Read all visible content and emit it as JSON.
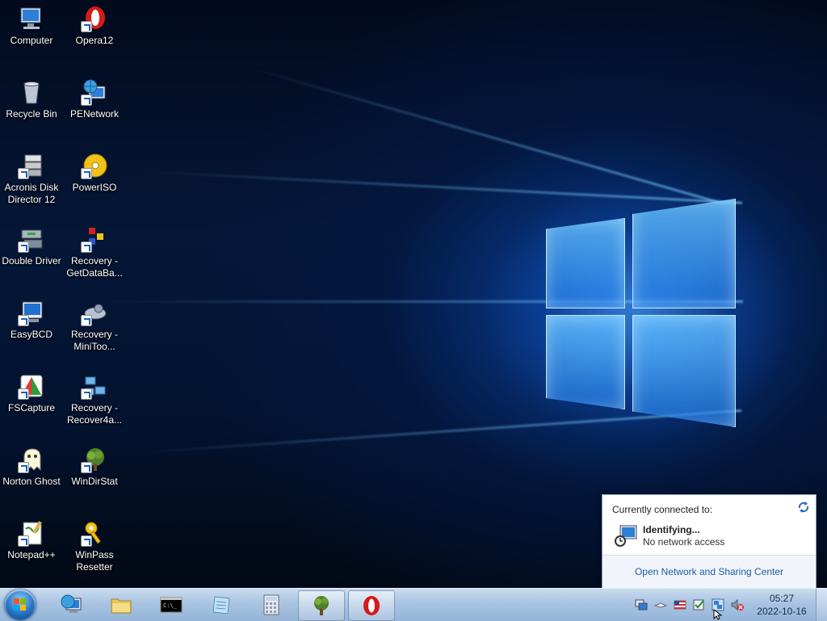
{
  "desktop": {
    "icons": [
      {
        "label": "Computer",
        "icon": "computer-icon"
      },
      {
        "label": "Opera12",
        "icon": "opera-icon"
      },
      {
        "label": "Recycle Bin",
        "icon": "recycle-bin-icon"
      },
      {
        "label": "PENetwork",
        "icon": "network-globe-icon"
      },
      {
        "label": "Acronis Disk Director 12",
        "icon": "disk-director-icon"
      },
      {
        "label": "PowerISO",
        "icon": "disc-icon"
      },
      {
        "label": "Double Driver",
        "icon": "double-driver-icon"
      },
      {
        "label": "Recovery - GetDataBa...",
        "icon": "recovery-icon"
      },
      {
        "label": "EasyBCD",
        "icon": "easybcd-icon"
      },
      {
        "label": "Recovery - MiniToo...",
        "icon": "recovery-minitool-icon"
      },
      {
        "label": "FSCapture",
        "icon": "fscapture-icon"
      },
      {
        "label": "Recovery - Recover4a...",
        "icon": "recovery-folder-icon"
      },
      {
        "label": "Norton Ghost",
        "icon": "ghost-icon"
      },
      {
        "label": "WinDirStat",
        "icon": "windirstat-icon"
      },
      {
        "label": "Notepad++",
        "icon": "notepad-icon"
      },
      {
        "label": "WinPass Resetter",
        "icon": "key-icon"
      }
    ]
  },
  "network_popup": {
    "header": "Currently connected to:",
    "network_name": "Identifying...",
    "network_status": "No network access",
    "link": "Open Network and Sharing Center"
  },
  "taskbar": {
    "start": "start-orb-icon",
    "pinned": [
      "ie-icon",
      "folder-icon",
      "cmd-icon",
      "notepad-icon",
      "calculator-icon",
      "windirstat-icon",
      "opera-icon"
    ],
    "tray": [
      "network-monitor-icon",
      "arrow-icon",
      "flag-us-icon",
      "action-center-icon",
      "network-icon",
      "volume-muted-icon"
    ],
    "time": "05:27",
    "date": "2022-10-16"
  },
  "colors": {
    "taskbar_top": "#c9dcef",
    "link": "#1f5aa8",
    "desktop_glow": "#50aaff"
  }
}
